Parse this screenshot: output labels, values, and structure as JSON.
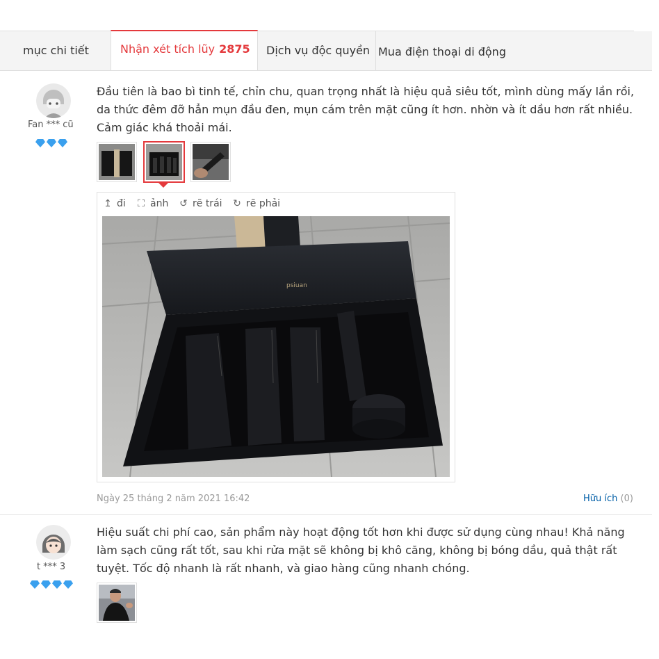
{
  "tabs": [
    {
      "label": "mục chi tiết"
    },
    {
      "label": "Nhận xét tích lũy",
      "count": "2875"
    },
    {
      "label": "Dịch vụ độc quyền"
    },
    {
      "label": "Mua điện thoại di động"
    }
  ],
  "reviews": [
    {
      "username": "Fan *** cũ",
      "level_icons": [
        "diamond-icon",
        "diamond-icon",
        "diamond-icon"
      ],
      "text": "Đầu tiên là bao bì tinh tế, chỉn chu, quan trọng nhất là hiệu quả siêu tốt, mình dùng mấy lần rồi, da thức đêm đỡ hẳn mụn đầu đen, mụn cám trên mặt cũng ít hơn. nhờn và ít dầu hơn rất nhiều. Cảm giác khá thoải mái.",
      "photos": [
        "photo-black-box",
        "photo-product-set",
        "photo-hand-tube"
      ],
      "selected_photo": 1,
      "viewer": {
        "tools": [
          {
            "label": "đi",
            "icon": "collapse-arrow-icon"
          },
          {
            "label": "ảnh",
            "icon": "fullscreen-icon"
          },
          {
            "label": "rẽ trái",
            "icon": "rotate-left-icon"
          },
          {
            "label": "rẽ phải",
            "icon": "rotate-right-icon"
          }
        ],
        "box_brand": "psiuan"
      },
      "date": "Ngày 25 tháng 2 năm 2021 16:42",
      "useful_label": "Hữu ích",
      "useful_count": "(0)"
    },
    {
      "username": "t *** 3",
      "level_icons": [
        "diamond-icon",
        "diamond-icon",
        "diamond-icon",
        "diamond-icon"
      ],
      "text": "Hiệu suất chi phí cao, sản phẩm này hoạt động tốt hơn khi được sử dụng cùng nhau! Khả năng làm sạch cũng rất tốt, sau khi rửa mặt sẽ không bị khô căng, không bị bóng dầu, quả thật rất tuyệt. Tốc độ nhanh là rất nhanh, và giao hàng cũng nhanh chóng.",
      "photos": [
        "photo-man"
      ]
    }
  ],
  "colors": {
    "accent": "#e4393c",
    "link": "#005ea7",
    "gem": "#3aa0ee"
  }
}
